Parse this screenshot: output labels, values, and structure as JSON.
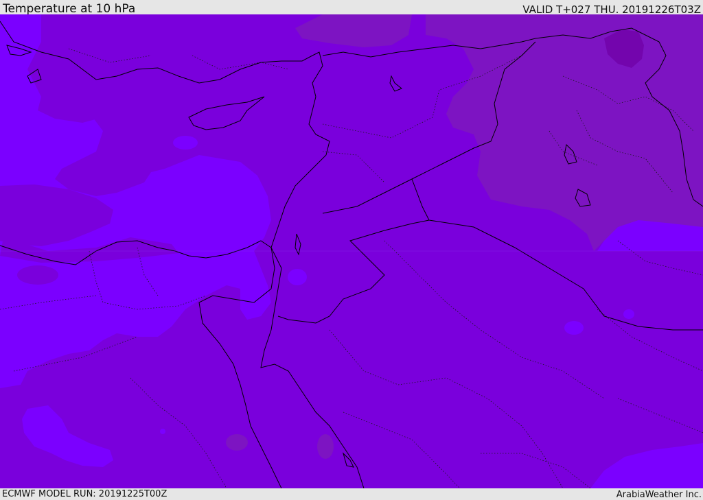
{
  "header": {
    "title": "Temperature at 10 hPa",
    "valid_time": "VALID T+027 THU. 20191226T03Z"
  },
  "footer": {
    "model_run": "ECMWF MODEL RUN: 20191225T00Z",
    "credit": "ArabiaWeather Inc."
  },
  "map": {
    "colors": {
      "base_field": "#7a00dc",
      "cold_field": "#7b00ff",
      "warm_field": "#7d14c2",
      "warmest_field": "#7305ad",
      "coastline": "#000000",
      "borders": "#1a1a1a"
    }
  }
}
